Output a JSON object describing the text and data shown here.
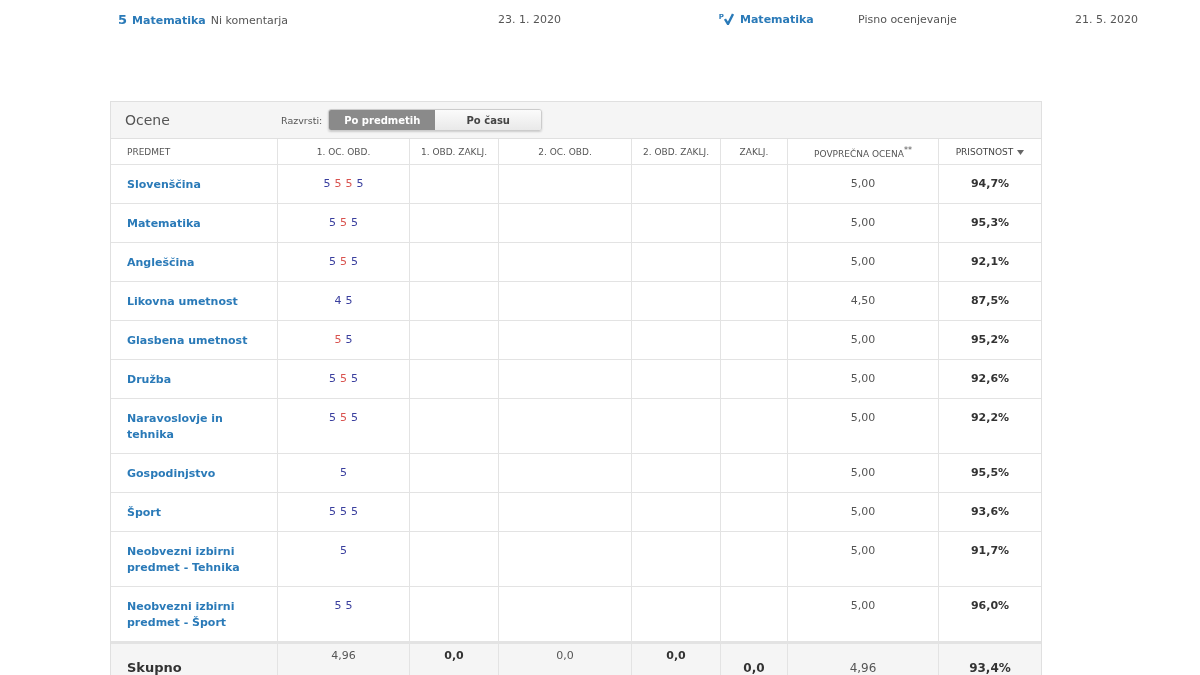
{
  "recent": [
    {
      "grade": "5",
      "subject": "Matematika",
      "comment": "Ni komentarja",
      "date": "23. 1. 2020",
      "exam_mark": "P",
      "exam_subject": "Matematika",
      "exam_type": "Pisno ocenjevanje",
      "exam_date": "21. 5. 2020"
    }
  ],
  "grades_panel": {
    "title": "Ocene",
    "sort_label": "Razvrsti:",
    "sort_options": [
      {
        "label": "Po predmetih",
        "selected": true
      },
      {
        "label": "Po času",
        "selected": false
      }
    ],
    "columns": [
      {
        "label": "PREDMET",
        "sorted": false
      },
      {
        "label": "1. OC. OBD.",
        "sorted": false
      },
      {
        "label": "1. OBD. ZAKLJ.",
        "sorted": false
      },
      {
        "label": "2. OC. OBD.",
        "sorted": false
      },
      {
        "label": "2. OBD. ZAKLJ.",
        "sorted": false
      },
      {
        "label": "ZAKLJ.",
        "sorted": false
      },
      {
        "label": "POVPREČNA OCENA$^{**}$",
        "sorted": false
      },
      {
        "label": "PRISOTNOST",
        "sorted": true
      }
    ],
    "rows": [
      {
        "subject": "Slovenščina",
        "grades": [
          {
            "value": "5",
            "color": "#3a3f9e"
          },
          {
            "value": "5",
            "color": "#d9534f"
          },
          {
            "value": "5",
            "color": "#d9534f"
          },
          {
            "value": "5",
            "color": "#3a3f9e"
          }
        ],
        "average": "5,00",
        "attendance": "94,7%"
      },
      {
        "subject": "Matematika",
        "grades": [
          {
            "value": "5",
            "color": "#3a3f9e"
          },
          {
            "value": "5",
            "color": "#d9534f"
          },
          {
            "value": "5",
            "color": "#3a3f9e"
          }
        ],
        "average": "5,00",
        "attendance": "95,3%"
      },
      {
        "subject": "Angleščina",
        "grades": [
          {
            "value": "5",
            "color": "#3a3f9e"
          },
          {
            "value": "5",
            "color": "#d9534f"
          },
          {
            "value": "5",
            "color": "#3a3f9e"
          }
        ],
        "average": "5,00",
        "attendance": "92,1%"
      },
      {
        "subject": "Likovna umetnost",
        "grades": [
          {
            "value": "4",
            "color": "#3a3f9e"
          },
          {
            "value": "5",
            "color": "#3a3f9e"
          }
        ],
        "average": "4,50",
        "attendance": "87,5%"
      },
      {
        "subject": "Glasbena umetnost",
        "grades": [
          {
            "value": "5",
            "color": "#d9534f"
          },
          {
            "value": "5",
            "color": "#3a3f9e"
          }
        ],
        "average": "5,00",
        "attendance": "95,2%"
      },
      {
        "subject": "Družba",
        "grades": [
          {
            "value": "5",
            "color": "#3a3f9e"
          },
          {
            "value": "5",
            "color": "#d9534f"
          },
          {
            "value": "5",
            "color": "#3a3f9e"
          }
        ],
        "average": "5,00",
        "attendance": "92,6%"
      },
      {
        "subject": "Naravoslovje in tehnika",
        "grades": [
          {
            "value": "5",
            "color": "#3a3f9e"
          },
          {
            "value": "5",
            "color": "#d9534f"
          },
          {
            "value": "5",
            "color": "#3a3f9e"
          }
        ],
        "average": "5,00",
        "attendance": "92,2%"
      },
      {
        "subject": "Gospodinjstvo",
        "grades": [
          {
            "value": "5",
            "color": "#3a3f9e"
          }
        ],
        "average": "5,00",
        "attendance": "95,5%"
      },
      {
        "subject": "Šport",
        "grades": [
          {
            "value": "5",
            "color": "#3a3f9e"
          },
          {
            "value": "5",
            "color": "#3a3f9e"
          },
          {
            "value": "5",
            "color": "#3a3f9e"
          }
        ],
        "average": "5,00",
        "attendance": "93,6%"
      },
      {
        "subject": "Neobvezni izbirni predmet - Tehnika",
        "grades": [
          {
            "value": "5",
            "color": "#3a3f9e"
          }
        ],
        "average": "5,00",
        "attendance": "91,7%"
      },
      {
        "subject": "Neobvezni izbirni predmet - Šport",
        "grades": [
          {
            "value": "5",
            "color": "#3a3f9e"
          },
          {
            "value": "5",
            "color": "#3a3f9e"
          }
        ],
        "average": "5,00",
        "attendance": "96,0%"
      }
    ],
    "total": {
      "label": "Skupno",
      "period1_grades": "4,96",
      "period1_final": "0,0",
      "period2_grades": "0,0",
      "period2_final": "0,0",
      "final": "0,0",
      "average": "4,96",
      "attendance": "93,4%"
    }
  }
}
